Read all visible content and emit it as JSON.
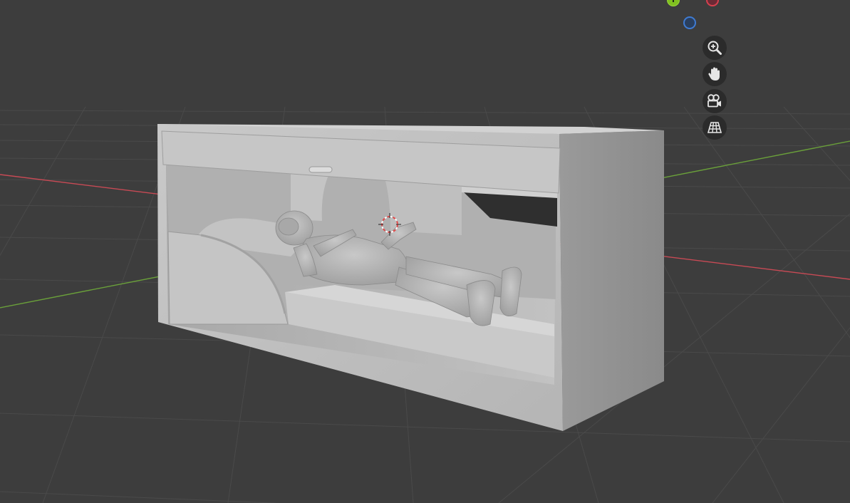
{
  "viewport": {
    "background": "#3d3d3d",
    "grid_color": "#4a4a4a",
    "x_axis_color": "#c84a55",
    "y_axis_color": "#6aa03a"
  },
  "gizmo": {
    "y_label": "Y",
    "y_color": "#80c020",
    "x_neg_color": "#d6404e",
    "z_neg_color": "#3f7bd3"
  },
  "nav_buttons": [
    {
      "icon": "zoom-in-icon"
    },
    {
      "icon": "hand-pan-icon"
    },
    {
      "icon": "camera-icon"
    },
    {
      "icon": "grid-perspective-icon"
    }
  ],
  "scene": {
    "object": "pod-cabinet-with-astronaut",
    "model_color": "#b8b8b8",
    "origin_marker_color": "#e04a4a"
  }
}
